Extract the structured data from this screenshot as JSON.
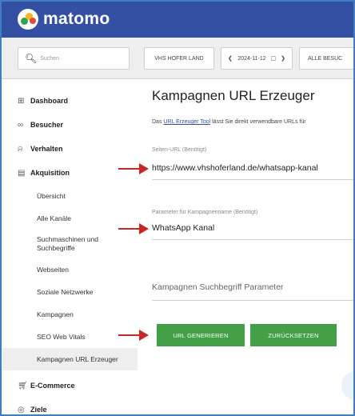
{
  "header": {
    "logo_text": "matomo"
  },
  "toolbar": {
    "search_placeholder": "Suchen",
    "site_label": "VHS HOFER LAND",
    "date_label": "2024-11-12",
    "segment_label": "ALLE BESUC"
  },
  "sidebar": {
    "dashboard": "Dashboard",
    "visitors": "Besucher",
    "behaviour": "Verhalten",
    "acquisition": "Akquisition",
    "acquisition_items": [
      "Übersicht",
      "Alle Kanäle",
      "Suchmaschinen und Suchbegriffe",
      "Webseiten",
      "Soziale Netzwerke",
      "Kampagnen",
      "SEO Web Vitals",
      "Kampagnen URL Erzeuger"
    ],
    "ecommerce": "E-Commerce",
    "goals": "Ziele"
  },
  "main": {
    "title": "Kampagnen URL Erzeuger",
    "desc_prefix": "Das ",
    "desc_link": "URL Erzeuger Tool",
    "desc_suffix": " lässt Sie direkt verwendbare URLs für",
    "url_label": "Seiten-URL (Benötigt)",
    "url_value": "https://www.vhshoferland.de/whatsapp-kanal",
    "campaign_label": "Parameter für Kampagnenname (Benötigt)",
    "campaign_value": "WhatsApp Kanal",
    "keyword_placeholder": "Kampagnen Suchbegriff Parameter",
    "generate_button": "URL GENERIEREN",
    "reset_button": "ZURÜCKSETZEN"
  },
  "colors": {
    "header_bg": "#3450a3",
    "button_green": "#43a047",
    "arrow_red": "#c62828",
    "frame_blue": "#3f7fbf"
  }
}
